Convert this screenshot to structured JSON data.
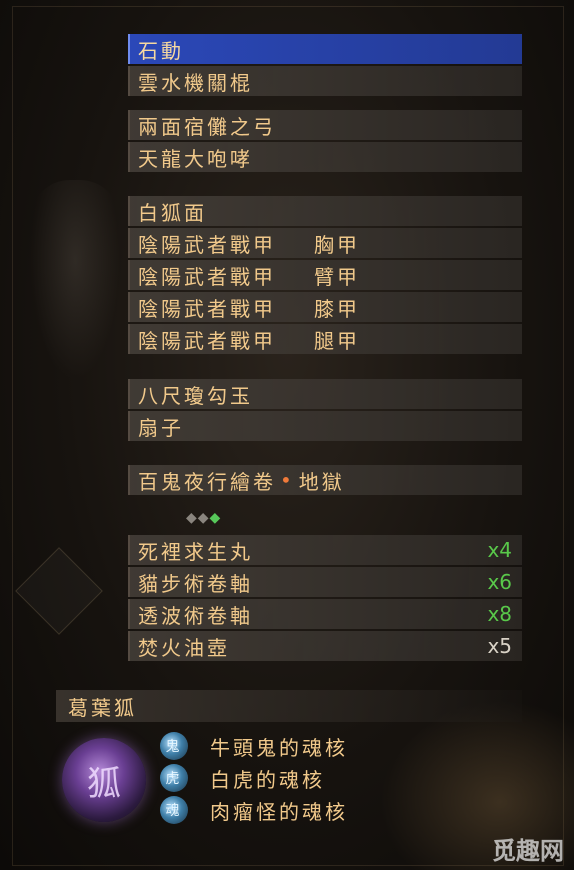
{
  "inventory": {
    "group1": [
      {
        "name": "石動"
      },
      {
        "name": "雲水機關棍"
      }
    ],
    "group2": [
      {
        "name": "兩面宿儺之弓"
      },
      {
        "name": "天龍大咆哮"
      }
    ],
    "group3": [
      {
        "name": "白狐面",
        "part": ""
      },
      {
        "name": "陰陽武者戰甲",
        "part": "胸甲"
      },
      {
        "name": "陰陽武者戰甲",
        "part": "臂甲"
      },
      {
        "name": "陰陽武者戰甲",
        "part": "膝甲"
      },
      {
        "name": "陰陽武者戰甲",
        "part": "腿甲"
      }
    ],
    "group4": [
      {
        "name": "八尺瓊勾玉"
      },
      {
        "name": "扇子"
      }
    ],
    "set_bonus": {
      "left": "百鬼夜行繪卷",
      "separator": "•",
      "right": "地獄"
    },
    "consumables": [
      {
        "name": "死裡求生丸",
        "qty": "x4"
      },
      {
        "name": "貓步術卷軸",
        "qty": "x6"
      },
      {
        "name": "透波術卷軸",
        "qty": "x8"
      },
      {
        "name": "焚火油壺",
        "qty": "x5"
      }
    ]
  },
  "gems": {
    "grey": "◆◆",
    "green": "◆"
  },
  "guardian_spirit": {
    "name": "葛葉狐",
    "orb_glyph": "狐",
    "cores": [
      {
        "label": "牛頭鬼的魂核",
        "icon": "鬼"
      },
      {
        "label": "白虎的魂核",
        "icon": "虎"
      },
      {
        "label": "肉瘤怪的魂核",
        "icon": "魂"
      }
    ]
  },
  "watermark": "觅趣网",
  "colors": {
    "selected": "#2b48b8",
    "text": "#f1c98b",
    "qty_green": "#59c84a"
  }
}
